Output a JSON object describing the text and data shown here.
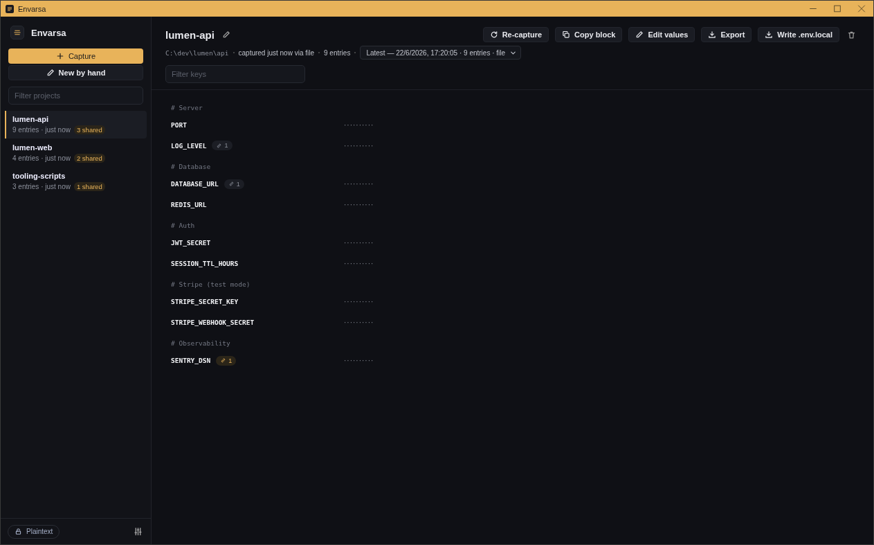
{
  "window": {
    "title": "Envarsa"
  },
  "sidebar": {
    "app_name": "Envarsa",
    "capture_button": "Capture",
    "new_button": "New by hand",
    "filter": {
      "placeholder": "Filter projects"
    },
    "projects": [
      {
        "name": "lumen-api",
        "meta": "9 entries · just now",
        "shared": "3 shared",
        "selected": true
      },
      {
        "name": "lumen-web",
        "meta": "4 entries · just now",
        "shared": "2 shared",
        "selected": false
      },
      {
        "name": "tooling-scripts",
        "meta": "3 entries · just now",
        "shared": "1 shared",
        "selected": false
      }
    ],
    "mode_button": "Plaintext"
  },
  "header": {
    "title": "lumen-api",
    "path": "C:\\dev\\lumen\\api",
    "captured": "captured just now via file",
    "entries": "9 entries",
    "snapshot": "Latest — 22/6/2026, 17:20:05 · 9 entries · file",
    "actions": [
      {
        "label": "Re-capture",
        "kind": "refresh"
      },
      {
        "label": "Copy block",
        "kind": "copy"
      },
      {
        "label": "Edit values",
        "kind": "edit"
      },
      {
        "label": "Export",
        "kind": "download"
      },
      {
        "label": "Write .env.local",
        "kind": "download"
      }
    ],
    "filter": {
      "placeholder": "Filter keys"
    }
  },
  "groups": [
    {
      "heading": "# Server",
      "entries": [
        {
          "key": "PORT",
          "value": "··········"
        },
        {
          "key": "LOG_LEVEL",
          "links": "1",
          "accent": false,
          "value": "··········"
        }
      ]
    },
    {
      "heading": "# Database",
      "entries": [
        {
          "key": "DATABASE_URL",
          "links": "1",
          "accent": false,
          "value": "··········"
        },
        {
          "key": "REDIS_URL",
          "value": "··········"
        }
      ]
    },
    {
      "heading": "# Auth",
      "entries": [
        {
          "key": "JWT_SECRET",
          "value": "··········"
        },
        {
          "key": "SESSION_TTL_HOURS",
          "value": "··········"
        }
      ]
    },
    {
      "heading": "# Stripe (test mode)",
      "entries": [
        {
          "key": "STRIPE_SECRET_KEY",
          "value": "··········"
        },
        {
          "key": "STRIPE_WEBHOOK_SECRET",
          "value": "··········"
        }
      ]
    },
    {
      "heading": "# Observability",
      "entries": [
        {
          "key": "SENTRY_DSN",
          "links": "1",
          "accent": true,
          "value": "··········"
        }
      ]
    }
  ]
}
